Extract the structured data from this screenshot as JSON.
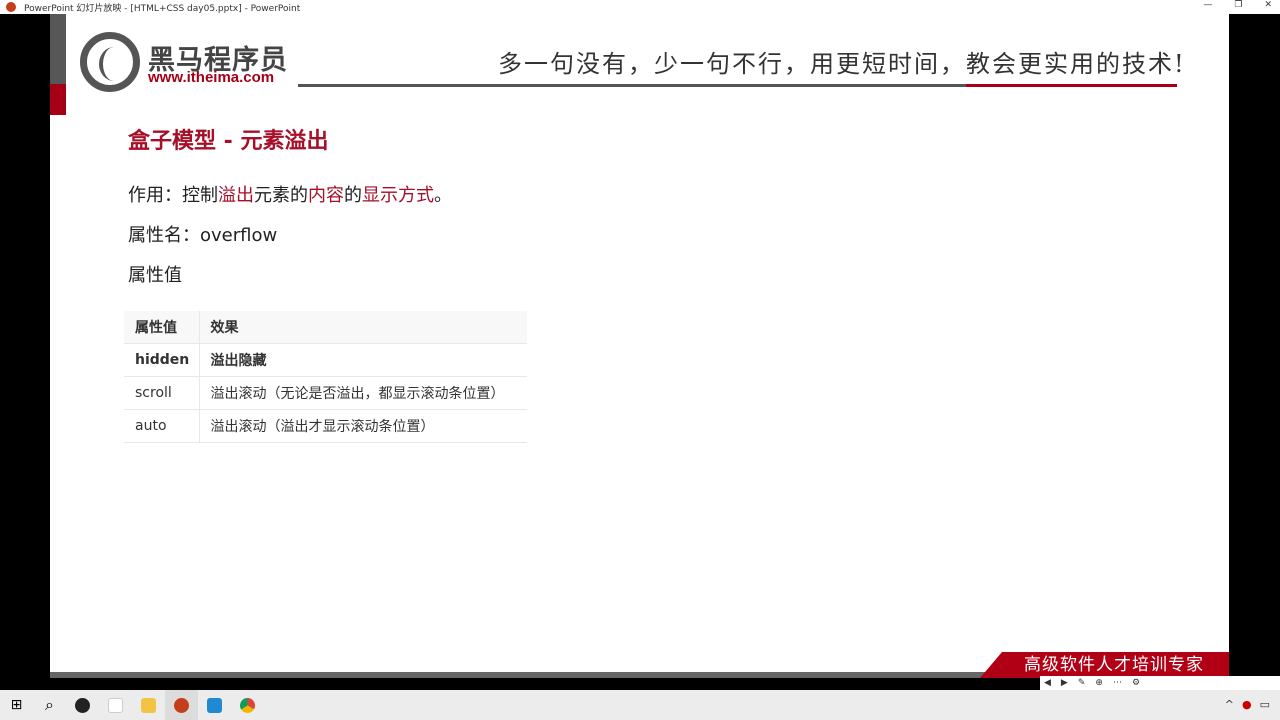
{
  "window": {
    "title": "PowerPoint 幻灯片放映 - [HTML+CSS day05.pptx] - PowerPoint"
  },
  "header": {
    "brand": "黑马程序员",
    "url": "www.itheima.com",
    "slogan": "多一句没有，少一句不行，用更短时间，教会更实用的技术!"
  },
  "slide": {
    "title": "盒子模型 - 元素溢出",
    "purpose": {
      "label": "作用：控制",
      "w1": "溢出",
      "t2": "元素的",
      "w2": "内容",
      "t3": "的",
      "w3": "显示方式",
      "t4": "。"
    },
    "prop_name": "属性名：overflow",
    "prop_value_label": "属性值",
    "table": {
      "headers": [
        "属性值",
        "效果"
      ],
      "rows": [
        [
          "hidden",
          "溢出隐藏"
        ],
        [
          "scroll",
          "溢出滚动（无论是否溢出，都显示滚动条位置）"
        ],
        [
          "auto",
          "溢出滚动（溢出才显示滚动条位置）"
        ]
      ]
    }
  },
  "footer": {
    "banner": "高级软件人才培训专家"
  },
  "colors": {
    "accent": "#a50f28",
    "gray": "#575757"
  }
}
